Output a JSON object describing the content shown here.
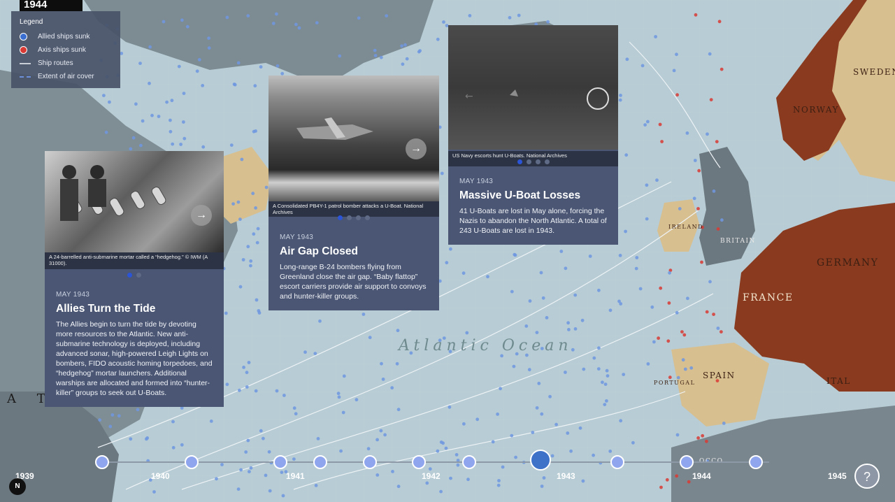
{
  "header": {
    "year": "1944"
  },
  "legend": {
    "title": "Legend",
    "items": [
      {
        "label": "Allied ships sunk",
        "symbol": "blue-dot",
        "color": "#3a6fd1"
      },
      {
        "label": "Axis ships sunk",
        "symbol": "red-dot",
        "color": "#d93a34"
      },
      {
        "label": "Ship routes",
        "symbol": "line",
        "color": "#c9cdd6"
      },
      {
        "label": "Extent of air cover",
        "symbol": "dashed-line",
        "color": "#6d8fd9"
      }
    ]
  },
  "map_labels": {
    "ocean": "Atlantic Ocean",
    "norway": "NORWAY",
    "sweden": "SWEDEN",
    "britain": "BRITAIN",
    "ireland": "IRELAND",
    "germany": "GERMANY",
    "france": "FRANCE",
    "spain": "SPAIN",
    "portugal": "PORTUGAL",
    "italy": "ITAL",
    "morocco": "OCCO",
    "left_fragment": "A T"
  },
  "cards": [
    {
      "date": "MAY 1943",
      "heading": "Allies Turn the Tide",
      "text": "The Allies begin to turn the tide by devoting more resources to the Atlantic. New anti-submarine technology is deployed, including advanced sonar, high-powered Leigh Lights on bombers, FIDO acoustic homing torpedoes, and “hedgehog” mortar launchers. Additional warships are allocated and formed into “hunter-killer” groups to seek out U-Boats.",
      "caption": "A 24-barrelled anti-submarine mortar called a “hedgehog.” © IWM (A 31000).",
      "slides": 2,
      "active_slide": 1
    },
    {
      "date": "MAY 1943",
      "heading": "Air Gap Closed",
      "text": "Long-range B-24 bombers flying from Greenland close the air gap. “Baby flattop” escort carriers provide air support to convoys and hunter-killer groups.",
      "caption": "A Consolidated PB4Y-1 patrol bomber attacks a U-Boat. National Archives",
      "slides": 4,
      "active_slide": 1
    },
    {
      "date": "MAY 1943",
      "heading": "Massive U-Boat Losses",
      "text": "41 U-Boats are lost in May alone, forcing the Nazis to abandon the North Atlantic. A total of 243 U-Boats are lost in 1943.",
      "caption": "US Navy escorts hunt U-Boats. National Archives",
      "slides": 4,
      "active_slide": 1
    }
  ],
  "timeline": {
    "years": [
      "1939",
      "1940",
      "1941",
      "1942",
      "1943",
      "1944",
      "1945"
    ],
    "active_year": "1943"
  },
  "controls": {
    "help": "?",
    "north": "N"
  },
  "colors": {
    "panel": "#4a5673",
    "allied": "#3a6fd1",
    "axis": "#d93a34",
    "axis_land": "#8a3a1f",
    "neutral_land": "#d8bf8f"
  }
}
